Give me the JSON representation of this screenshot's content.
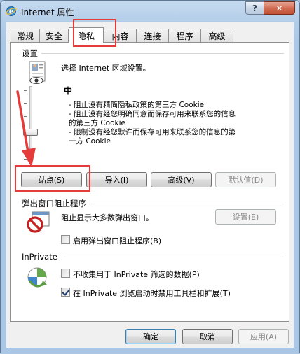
{
  "window": {
    "title": "Internet 属性",
    "help_glyph": "?",
    "close_glyph": "✕"
  },
  "tabs": [
    {
      "label": "常规"
    },
    {
      "label": "安全"
    },
    {
      "label": "隐私"
    },
    {
      "label": "内容"
    },
    {
      "label": "连接"
    },
    {
      "label": "程序"
    },
    {
      "label": "高级"
    }
  ],
  "active_tab": "隐私",
  "settings": {
    "heading": "设置",
    "zone_prompt": "选择 Internet 区域设置。",
    "level": "中",
    "level_fraction": 0.5,
    "description": [
      "- 阻止没有精简隐私政策的第三方 Cookie",
      "- 阻止没有经您明确同意而保存可用来联系您的信息",
      "的第三方 Cookie",
      "- 限制没有经您默许而保存可用来联系您的信息的第",
      "一方 Cookie"
    ],
    "buttons": {
      "sites": "站点(S)",
      "import": "导入(I)",
      "advanced": "高级(V)",
      "default": "默认值(D)"
    }
  },
  "popup_blocker": {
    "heading": "弹出窗口阻止程序",
    "description": "阻止显示大多数弹出窗口。",
    "settings_button": "设置(E)",
    "enable_label": "启用弹出窗口阻止程序(B)",
    "enable_checked": false
  },
  "inprivate": {
    "heading": "InPrivate",
    "option1_label": "不收集用于 InPrivate 筛选的数据(P)",
    "option1_checked": false,
    "option2_label": "在 InPrivate 浏览启动时禁用工具栏和扩展(T)",
    "option2_checked": true
  },
  "footer": {
    "ok": "确定",
    "cancel": "取消",
    "apply": "应用(A)"
  },
  "annotation_color": "#e43b3b"
}
